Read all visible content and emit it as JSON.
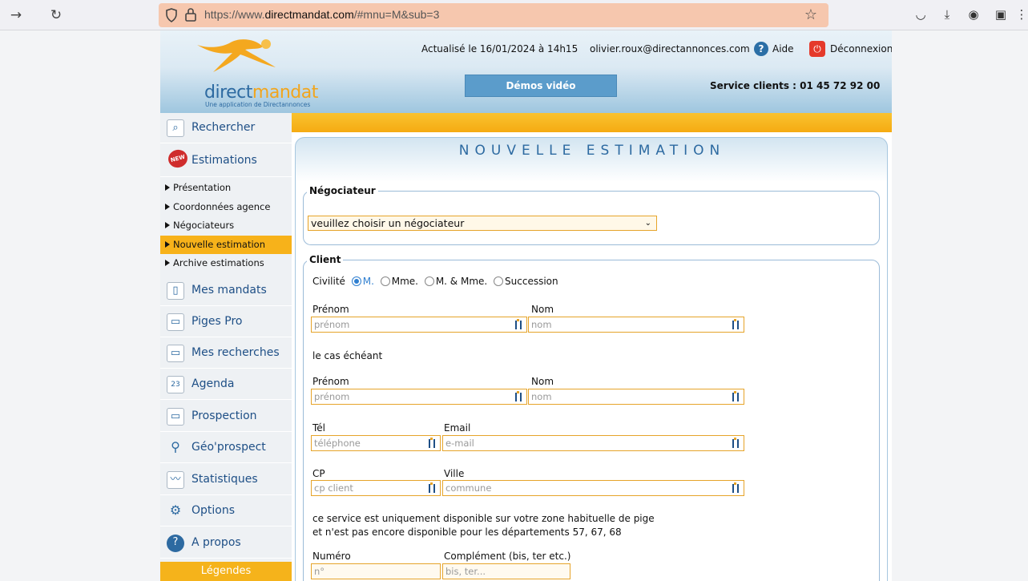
{
  "browser": {
    "url_prefix": "https://www.",
    "url_domain": "directmandat.com",
    "url_rest": "/#mnu=M&sub=3"
  },
  "header": {
    "brand_a": "direct",
    "brand_b": "mandat",
    "tagline": "Une application de Directannonces",
    "updated": "Actualisé le 16/01/2024 à 14h15",
    "email": "olivier.roux@directannonces.com",
    "help_label": "Aide",
    "logout_label": "Déconnexion",
    "demo_button": "Démos vidéo",
    "service": "Service clients : 01 45 72 92 00"
  },
  "sidebar": {
    "search": "Rechercher",
    "estimations": "Estimations",
    "new_badge": "NEW",
    "sub_items": [
      "Présentation",
      "Coordonnées agence",
      "Négociateurs",
      "Nouvelle estimation",
      "Archive estimations"
    ],
    "mandats": "Mes mandats",
    "piges": "Piges Pro",
    "recherches": "Mes recherches",
    "agenda": "Agenda",
    "agenda_day": "23",
    "prospection": "Prospection",
    "geoprospect": "Géo'prospect",
    "statistiques": "Statistiques",
    "options": "Options",
    "apropos": "A propos",
    "legendes": "Légendes"
  },
  "form": {
    "title": "NOUVELLE ESTIMATION",
    "negociateur_legend": "Négociateur",
    "negociateur_select": "veuillez choisir un négociateur",
    "client_legend": "Client",
    "civilite_label": "Civilité",
    "civilite_options": [
      "M.",
      "Mme.",
      "M. & Mme.",
      "Succession"
    ],
    "prenom_label": "Prénom",
    "nom_label": "Nom",
    "prenom_placeholder": "prénom",
    "nom_placeholder": "nom",
    "cas_echeant": "le cas échéant",
    "tel_label": "Tél",
    "tel_placeholder": "téléphone",
    "email_label": "Email",
    "email_placeholder": "e-mail",
    "cp_label": "CP",
    "cp_placeholder": "cp client",
    "ville_label": "Ville",
    "ville_placeholder": "commune",
    "notice_1": "ce service est uniquement disponible sur votre zone habituelle de pige",
    "notice_2": "et n'est pas encore disponible pour les départements 57, 67, 68",
    "numero_label": "Numéro",
    "numero_placeholder": "n°",
    "complement_label": "Complément (bis, ter etc.)",
    "complement_placeholder": "bis, ter..."
  }
}
